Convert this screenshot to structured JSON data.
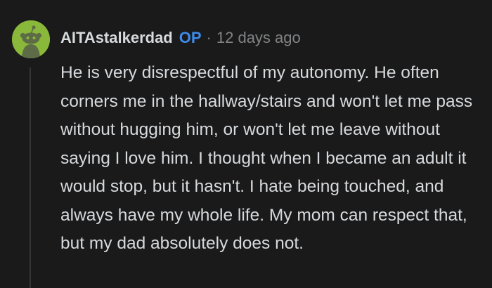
{
  "comment": {
    "username": "AITAstalkerdad",
    "badge": "OP",
    "separator": "·",
    "timestamp": "12 days ago",
    "body": "He is very disrespectful of my autonomy. He often corners me in the hallway/stairs and won't let me pass without hugging him, or won't let me leave without saying I love him. I thought when I became an adult it would stop, but it hasn't. I hate being touched, and always have my whole life. My mom can respect that, but my dad absolutely does not."
  },
  "colors": {
    "background": "#1a1a1b",
    "text": "#d7dadc",
    "meta": "#818384",
    "op_badge": "#3e8ae8",
    "avatar": "#8ab83a"
  },
  "icons": {
    "avatar": "snoo-avatar-icon"
  }
}
